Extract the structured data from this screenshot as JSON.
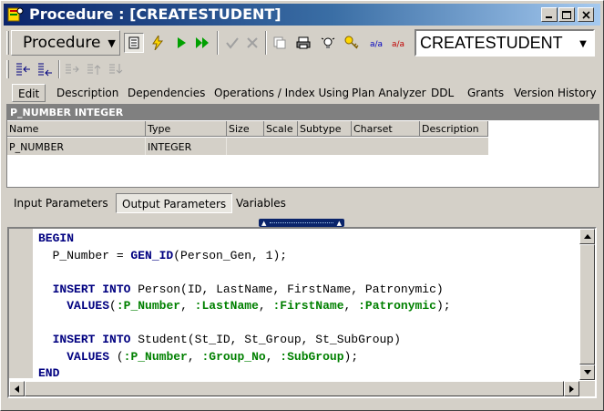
{
  "window": {
    "title": "Procedure : [CREATESTUDENT]",
    "controls": {
      "minimize": "_",
      "maximize": "□",
      "close": "✕"
    }
  },
  "toolbar": {
    "procedure_label": "Procedure",
    "procedure_arrow": "▼",
    "name_value": "CREATESTUDENT",
    "combo_arrow": "▼"
  },
  "tabs": [
    {
      "label": "Edit"
    },
    {
      "label": "Description"
    },
    {
      "label": "Dependencies"
    },
    {
      "label": "Operations / Index Using"
    },
    {
      "label": "Plan Analyzer"
    },
    {
      "label": "DDL"
    },
    {
      "label": "Grants"
    },
    {
      "label": "Version History"
    }
  ],
  "grid": {
    "header_bar": "P_NUMBER INTEGER",
    "columns": [
      "Name",
      "Type",
      "Size",
      "Scale",
      "Subtype",
      "Charset",
      "Description"
    ],
    "rows": [
      {
        "name": "P_NUMBER",
        "type": "INTEGER"
      }
    ]
  },
  "param_tabs": [
    {
      "label": "Input Parameters"
    },
    {
      "label": "Output Parameters"
    },
    {
      "label": "Variables"
    }
  ],
  "editor": {
    "lines": [
      "BEGIN",
      "  P_Number = GEN_ID(Person_Gen, 1);",
      "",
      "  INSERT INTO Person(ID, LastName, FirstName, Patronymic)",
      "    VALUES(:P_Number, :LastName, :FirstName, :Patronymic);",
      "",
      "  INSERT INTO Student(St_ID, St_Group, St_SubGroup)",
      "    VALUES (:P_Number, :Group_No, :SubGroup);",
      "END"
    ]
  },
  "colors": {
    "title_start": "#0a246a",
    "title_end": "#a6caf0",
    "keyword": "#000080",
    "parameter": "#008000"
  }
}
